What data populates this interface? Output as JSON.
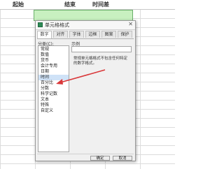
{
  "sheet": {
    "headers": [
      "起始",
      "结束",
      "时间差"
    ]
  },
  "dialog": {
    "title": "单元格格式",
    "tabs": [
      {
        "label": "数字",
        "active": true
      },
      {
        "label": "对齐",
        "active": false
      },
      {
        "label": "字体",
        "active": false
      },
      {
        "label": "边框",
        "active": false
      },
      {
        "label": "图案",
        "active": false
      },
      {
        "label": "保护",
        "active": false
      }
    ],
    "category_label": "分类(C):",
    "categories": [
      "常规",
      "数值",
      "货币",
      "会计专用",
      "日期",
      "时间",
      "百分比",
      "分数",
      "科学记数",
      "文本",
      "特殊",
      "自定义"
    ],
    "selected_category": "时间",
    "sample_label": "示例",
    "description": "常规单元格格式不包含任何特定的数字格式。",
    "ok_label": "确定",
    "cancel_label": "取消"
  },
  "colors": {
    "highlight_band": "#c8f0c0",
    "arrow": "#d9383a",
    "selected_item": "#cfe2f7"
  },
  "icons": {
    "app": "spreadsheet-app-icon",
    "close": "close-icon"
  }
}
